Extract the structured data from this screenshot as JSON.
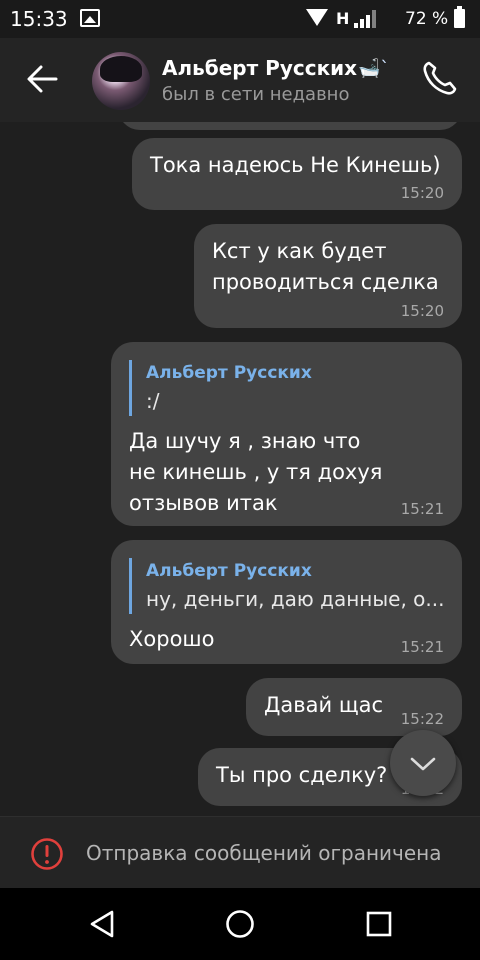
{
  "status_bar": {
    "time": "15:33",
    "network": "H",
    "battery": "72 %",
    "icons": [
      "gallery-icon",
      "wifi-icon",
      "signal-icon",
      "battery-icon"
    ]
  },
  "header": {
    "contact_name": "Альберт Русских",
    "status": "был в сети недавно",
    "icons": [
      "back-arrow-icon",
      "bathtub-emoji-icon",
      "phone-icon"
    ]
  },
  "messages": [
    {
      "text": "Тока надеюсь Не Кинешь)",
      "time": "15:20"
    },
    {
      "text_lines": [
        "Кст у как будет",
        "проводиться сделка"
      ],
      "time": "15:20"
    },
    {
      "reply_name": "Альберт Русских",
      "reply_text": ":/",
      "text_lines": [
        "Да шучу я , знаю что",
        "не кинешь , у тя дохуя",
        "отзывов итак"
      ],
      "time": "15:21"
    },
    {
      "reply_name": "Альберт Русских",
      "reply_text": "ну, деньги, даю данные, о...",
      "text": "Хорошо",
      "time": "15:21"
    },
    {
      "text": "Давай щас",
      "time": "15:22"
    },
    {
      "text": "Ты про сделку?",
      "time": "15:22"
    }
  ],
  "restriction": {
    "text": "Отправка сообщений ограничена",
    "icon": "alert-circle-icon"
  },
  "nav": {
    "icons": [
      "back-triangle-icon",
      "home-circle-icon",
      "recents-square-icon"
    ]
  },
  "colors": {
    "bubble": "#434343",
    "reply_accent": "#7ab2ea",
    "alert": "#e0403c",
    "background": "#1f1f1f"
  }
}
